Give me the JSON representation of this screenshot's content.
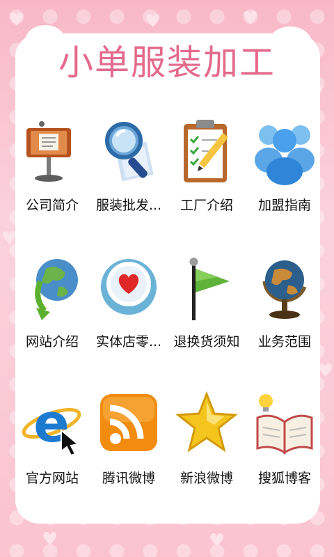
{
  "header": {
    "title": "小单服装加工"
  },
  "grid": {
    "items": [
      {
        "label": "公司简介",
        "icon": "presentation-lectern-icon"
      },
      {
        "label": "服装批发...",
        "icon": "magnifier-icon"
      },
      {
        "label": "工厂介绍",
        "icon": "clipboard-checklist-icon"
      },
      {
        "label": "加盟指南",
        "icon": "people-group-icon"
      },
      {
        "label": "网站介绍",
        "icon": "globe-arrow-icon"
      },
      {
        "label": "实体店零...",
        "icon": "heart-button-icon"
      },
      {
        "label": "退换货须知",
        "icon": "green-flag-icon"
      },
      {
        "label": "业务范围",
        "icon": "desk-globe-icon"
      },
      {
        "label": "官方网站",
        "icon": "internet-explorer-icon"
      },
      {
        "label": "腾讯微博",
        "icon": "rss-feed-icon"
      },
      {
        "label": "新浪微博",
        "icon": "star-icon"
      },
      {
        "label": "搜狐博客",
        "icon": "open-book-lightbulb-icon"
      }
    ]
  },
  "colors": {
    "background": "#f9c6d1",
    "title": "#e46a8c",
    "panel": "#ffffff"
  }
}
